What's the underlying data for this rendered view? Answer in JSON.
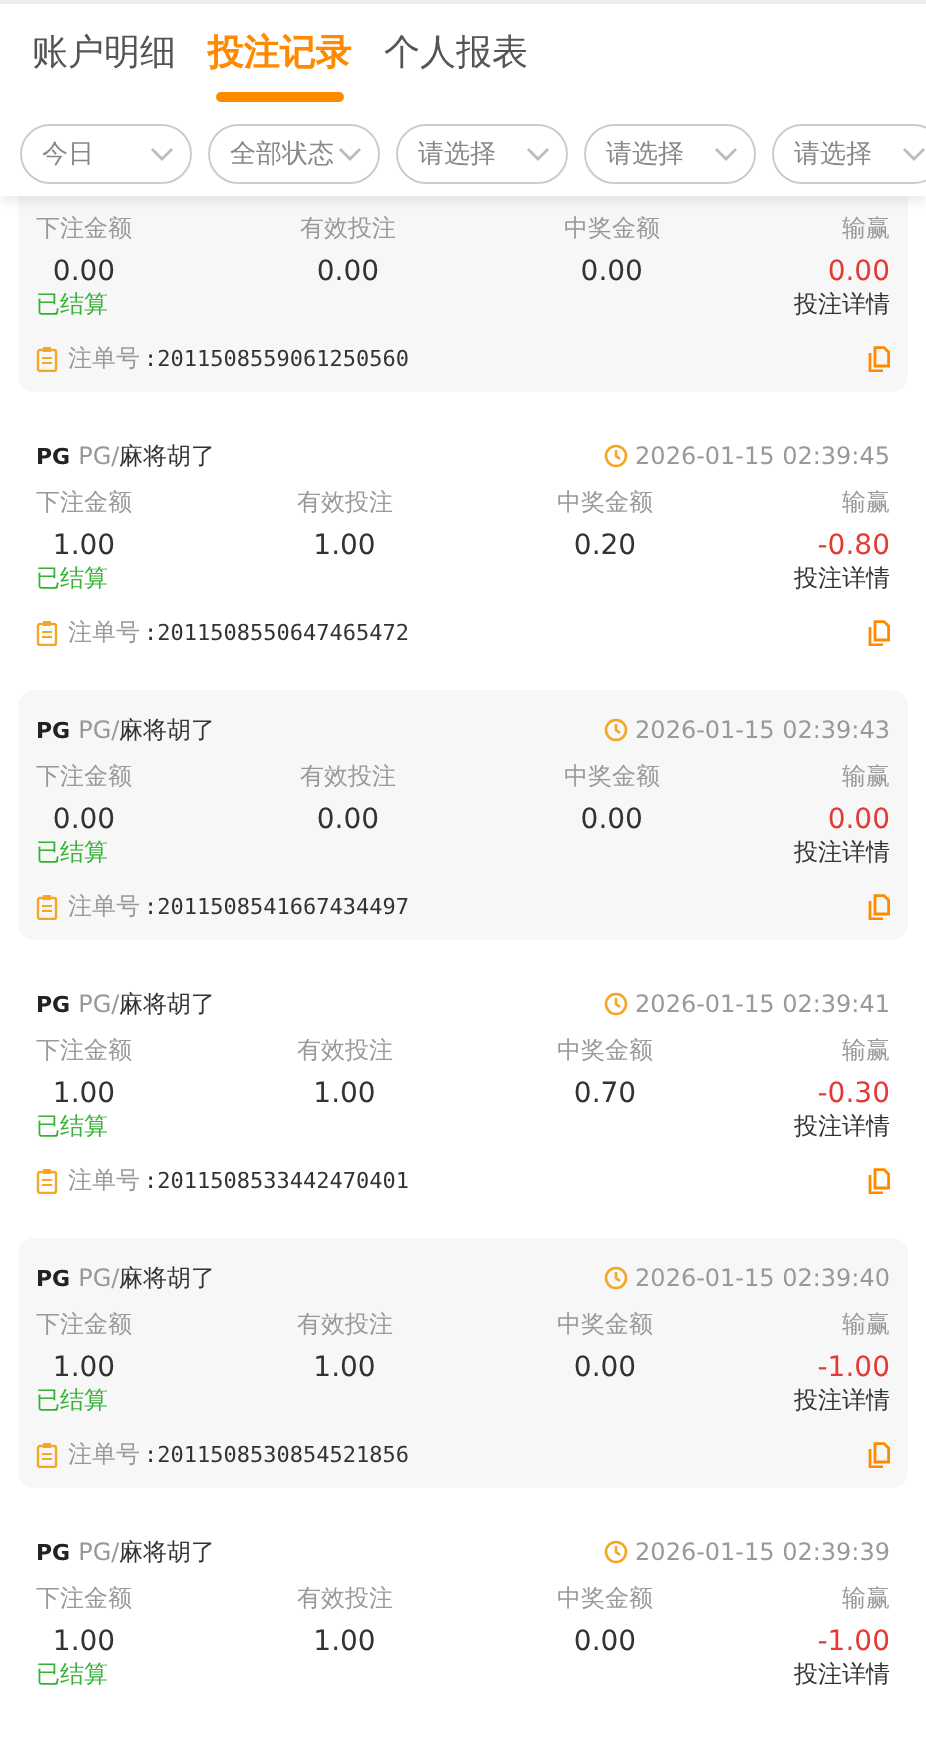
{
  "tabs": [
    {
      "label": "账户明细",
      "selected": false
    },
    {
      "label": "投注记录",
      "selected": true
    },
    {
      "label": "个人报表",
      "selected": false
    }
  ],
  "filters": [
    {
      "label": "今日"
    },
    {
      "label": "全部状态"
    },
    {
      "label": "请选择"
    },
    {
      "label": "请选择"
    },
    {
      "label": "请选择"
    }
  ],
  "records": [
    {
      "stats": [
        {
          "label": "下注金额",
          "value": "0.00"
        },
        {
          "label": "有效投注",
          "value": "0.00"
        },
        {
          "label": "中奖金额",
          "value": "0.00"
        },
        {
          "label": "输赢",
          "value": "0.00"
        }
      ],
      "status": "已结算",
      "detail": "投注详情",
      "order_label": "注单号",
      "order_no": ":2011508559061250560"
    },
    {
      "logo": "PG",
      "provider": "PG/",
      "game": "麻将胡了",
      "time": "2026-01-15 02:39:45",
      "stats": [
        {
          "label": "下注金额",
          "value": "1.00"
        },
        {
          "label": "有效投注",
          "value": "1.00"
        },
        {
          "label": "中奖金额",
          "value": "0.20"
        },
        {
          "label": "输赢",
          "value": "-0.80"
        }
      ],
      "status": "已结算",
      "detail": "投注详情",
      "order_label": "注单号",
      "order_no": ":2011508550647465472"
    },
    {
      "logo": "PG",
      "provider": "PG/",
      "game": "麻将胡了",
      "time": "2026-01-15 02:39:43",
      "stats": [
        {
          "label": "下注金额",
          "value": "0.00"
        },
        {
          "label": "有效投注",
          "value": "0.00"
        },
        {
          "label": "中奖金额",
          "value": "0.00"
        },
        {
          "label": "输赢",
          "value": "0.00"
        }
      ],
      "status": "已结算",
      "detail": "投注详情",
      "order_label": "注单号",
      "order_no": ":2011508541667434497"
    },
    {
      "logo": "PG",
      "provider": "PG/",
      "game": "麻将胡了",
      "time": "2026-01-15 02:39:41",
      "stats": [
        {
          "label": "下注金额",
          "value": "1.00"
        },
        {
          "label": "有效投注",
          "value": "1.00"
        },
        {
          "label": "中奖金额",
          "value": "0.70"
        },
        {
          "label": "输赢",
          "value": "-0.30"
        }
      ],
      "status": "已结算",
      "detail": "投注详情",
      "order_label": "注单号",
      "order_no": ":2011508533442470401"
    },
    {
      "logo": "PG",
      "provider": "PG/",
      "game": "麻将胡了",
      "time": "2026-01-15 02:39:40",
      "stats": [
        {
          "label": "下注金额",
          "value": "1.00"
        },
        {
          "label": "有效投注",
          "value": "1.00"
        },
        {
          "label": "中奖金额",
          "value": "0.00"
        },
        {
          "label": "输赢",
          "value": "-1.00"
        }
      ],
      "status": "已结算",
      "detail": "投注详情",
      "order_label": "注单号",
      "order_no": ":2011508530854521856"
    },
    {
      "logo": "PG",
      "provider": "PG/",
      "game": "麻将胡了",
      "time": "2026-01-15 02:39:39",
      "stats": [
        {
          "label": "下注金额",
          "value": "1.00"
        },
        {
          "label": "有效投注",
          "value": "1.00"
        },
        {
          "label": "中奖金额",
          "value": "0.00"
        },
        {
          "label": "输赢",
          "value": "-1.00"
        }
      ],
      "status": "已结算",
      "detail": "投注详情"
    }
  ]
}
